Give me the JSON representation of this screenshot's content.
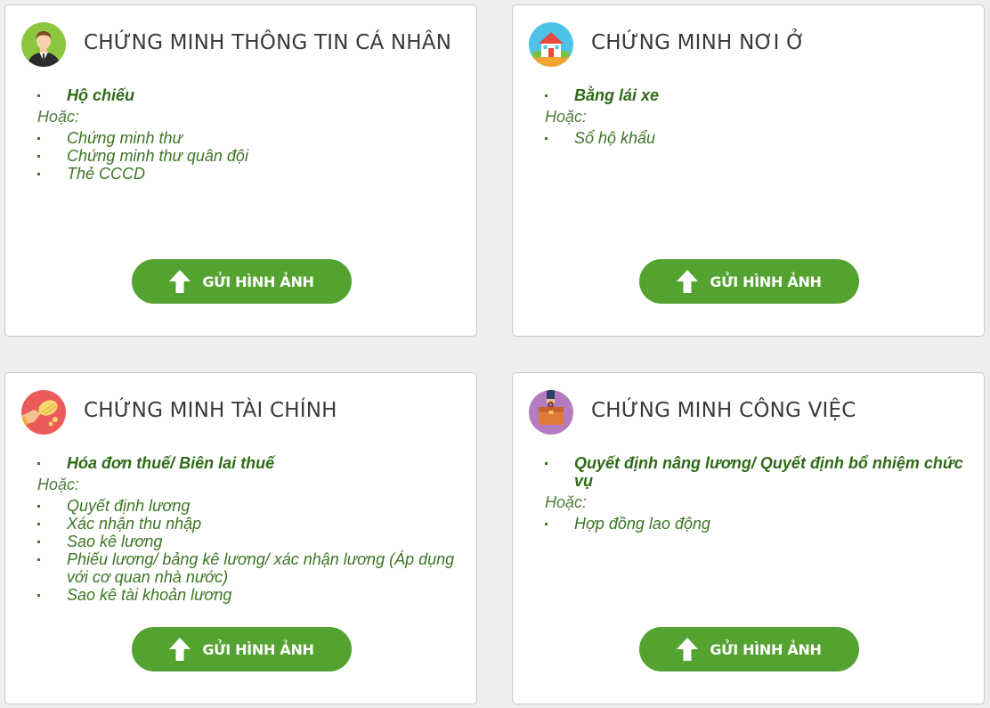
{
  "cards": [
    {
      "title": "CHỨNG MINH THÔNG TIN CÁ NHÂN",
      "icon": "person-icon",
      "primary": [
        "Hộ chiếu"
      ],
      "or_label": "Hoặc:",
      "items": [
        "Chứng minh thư",
        "Chứng minh thư quân đội",
        "Thẻ CCCD"
      ],
      "button_label": "GỬI HÌNH ẢNH"
    },
    {
      "title": "CHỨNG MINH NƠI Ở",
      "icon": "house-icon",
      "primary": [
        "Bằng lái xe"
      ],
      "or_label": "Hoặc:",
      "items": [
        "Sổ hộ khẩu"
      ],
      "button_label": "GỬI HÌNH ẢNH"
    },
    {
      "title": "CHỨNG MINH TÀI CHÍNH",
      "icon": "money-hand-icon",
      "primary": [
        "Hóa đơn thuế/ Biên lai thuế"
      ],
      "or_label": "Hoặc:",
      "items": [
        "Quyết định lương",
        "Xác nhận thu nhập",
        "Sao kê lương",
        "Phiếu lương/ bảng kê lương/ xác nhận lương (Áp dụng với cơ quan nhà nước)",
        "Sao kê tài khoản lương"
      ],
      "button_label": "GỬI HÌNH ẢNH"
    },
    {
      "title": "CHỨNG MINH CÔNG VIỆC",
      "icon": "briefcase-icon",
      "primary": [
        "Quyết định nâng lương/ Quyết định bổ nhiệm chức vụ"
      ],
      "or_label": "Hoặc:",
      "items": [
        "Hợp đồng lao động"
      ],
      "button_label": "GỬI HÌNH ẢNH"
    }
  ],
  "colors": {
    "accent_green": "#54a331",
    "text_green": "#3c7524",
    "title_gray": "#3a3a3a",
    "background": "#eeeeee"
  }
}
